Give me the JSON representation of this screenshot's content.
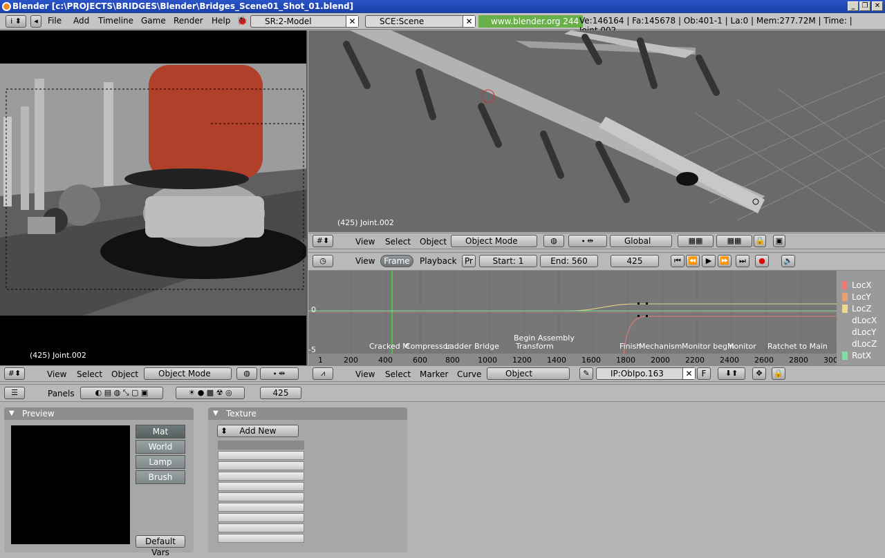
{
  "window": {
    "title": "Blender [c:\\PROJECTS\\BRIDGES\\Blender\\Bridges_Scene01_Shot_01.blend]",
    "controls": [
      "_",
      "❐",
      "✕"
    ]
  },
  "top_menu": {
    "items": [
      "File",
      "Add",
      "Timeline",
      "Game",
      "Render",
      "Help"
    ],
    "screen": "SR:2-Model",
    "scene": "SCE:Scene",
    "site": "www.blender.org 244",
    "stats": "Ve:146164 | Fa:145678 | Ob:401-1 | La:0  | Mem:277.72M  | Time: | Joint.002"
  },
  "viewport_left": {
    "label": "(425) Joint.002",
    "menus": [
      "View",
      "Select",
      "Object"
    ],
    "mode": "Object Mode"
  },
  "viewport_right": {
    "label": "(425) Joint.002",
    "menus": [
      "View",
      "Select",
      "Object"
    ],
    "mode": "Object Mode",
    "orientation": "Global"
  },
  "timeline": {
    "menus": [
      "View",
      "Frame",
      "Playback"
    ],
    "pr": "Pr",
    "start": "Start: 1",
    "end": "End: 560",
    "current_frame": "425"
  },
  "ipo": {
    "menus": [
      "View",
      "Select",
      "Marker",
      "Curve"
    ],
    "object": "Object",
    "ipo_name": "IP:ObIpo.163",
    "f": "F",
    "y_labels": [
      "0",
      "-5"
    ],
    "x_ticks": [
      "1",
      "200",
      "400",
      "600",
      "800",
      "1000",
      "1200",
      "1400",
      "1600",
      "1800",
      "2000",
      "2200",
      "2400",
      "2600",
      "2800",
      "300"
    ],
    "markers": [
      "Cracked M",
      "Compressor",
      "Ladder",
      "Bridge",
      "Begin Assembly",
      "Transform",
      "Finish",
      "Mechanism",
      "Monitor begin",
      "Monitor",
      "Ratchet to Main"
    ],
    "channels": [
      {
        "name": "LocX",
        "color": "#e87a7a"
      },
      {
        "name": "LocY",
        "color": "#e8a070"
      },
      {
        "name": "LocZ",
        "color": "#ecd98a"
      },
      {
        "name": "dLocX",
        "color": ""
      },
      {
        "name": "dLocY",
        "color": ""
      },
      {
        "name": "dLocZ",
        "color": ""
      },
      {
        "name": "RotX",
        "color": "#7ee0a0"
      }
    ]
  },
  "buttons": {
    "panels_label": "Panels",
    "frame": "425",
    "preview": {
      "title": "Preview",
      "tabs": [
        "Mat",
        "World",
        "Lamp",
        "Brush"
      ],
      "default_vars": "Default Vars"
    },
    "texture": {
      "title": "Texture",
      "add_new": "Add New"
    }
  }
}
